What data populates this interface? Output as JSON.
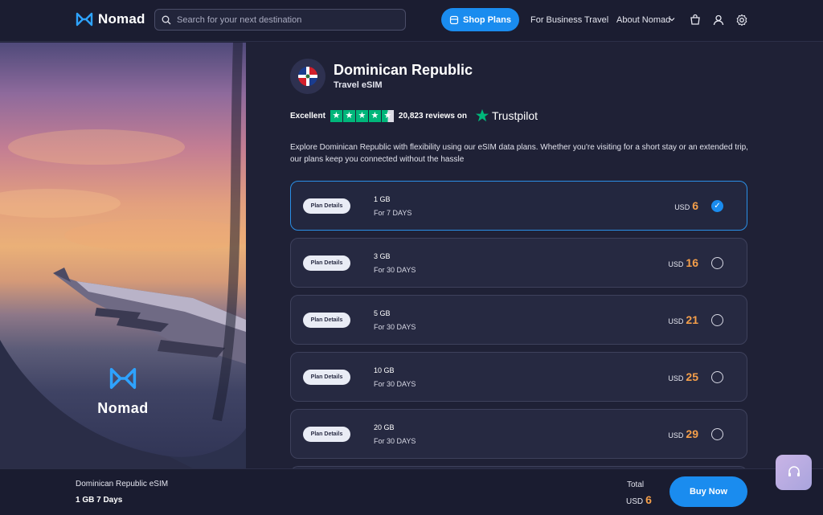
{
  "header": {
    "logo_text": "Nomad",
    "search_placeholder": "Search for your next destination",
    "shop_plans_label": "Shop Plans",
    "nav": [
      "For Business",
      "Travel",
      "About Nomad"
    ]
  },
  "hero": {
    "logo_text": "Nomad"
  },
  "product": {
    "country": "Dominican Republic",
    "subtitle": "Travel eSIM",
    "rating_label": "Excellent",
    "stars": 4.5,
    "reviews_text": "20,823 reviews on",
    "trustpilot_label": "Trustpilot",
    "description": "Explore Dominican Republic with flexibility using our eSIM data plans. Whether you're visiting for a short stay or an extended trip, our plans keep you connected without the hassle"
  },
  "plans": [
    {
      "details_label": "Plan Details",
      "data": "1 GB",
      "duration": "For 7 DAYS",
      "currency": "USD",
      "price": "6",
      "selected": true
    },
    {
      "details_label": "Plan Details",
      "data": "3 GB",
      "duration": "For 30 DAYS",
      "currency": "USD",
      "price": "16",
      "selected": false
    },
    {
      "details_label": "Plan Details",
      "data": "5 GB",
      "duration": "For 30 DAYS",
      "currency": "USD",
      "price": "21",
      "selected": false
    },
    {
      "details_label": "Plan Details",
      "data": "10 GB",
      "duration": "For 30 DAYS",
      "currency": "USD",
      "price": "25",
      "selected": false
    },
    {
      "details_label": "Plan Details",
      "data": "20 GB",
      "duration": "For 30 DAYS",
      "currency": "USD",
      "price": "29",
      "selected": false
    }
  ],
  "footer": {
    "product_name": "Dominican Republic eSIM",
    "selected_plan": "1 GB 7 Days",
    "total_label": "Total",
    "currency": "USD",
    "total_price": "6",
    "buy_label": "Buy Now"
  },
  "colors": {
    "accent": "#1a8cef",
    "price": "#f59f4a",
    "trustpilot_green": "#00b67a",
    "background": "#1f2136"
  }
}
